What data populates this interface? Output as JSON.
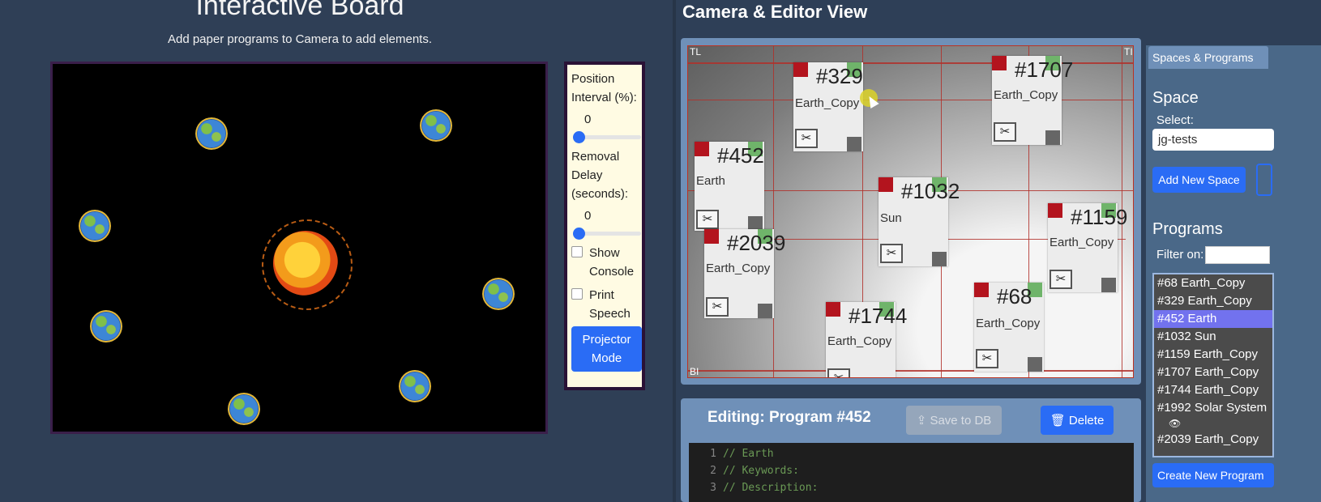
{
  "board": {
    "title": "Interactive Board",
    "subtitle": "Add paper programs to Camera to add elements."
  },
  "controls": {
    "position_interval_label": "Position Interval (%):",
    "position_interval_value": "0",
    "removal_delay_label": "Removal Delay (seconds):",
    "removal_delay_value": "0",
    "show_console_label": "Show Console",
    "print_speech_label": "Print Speech",
    "projector_mode_label": "Projector Mode",
    "slider_color": "#2a6cf5"
  },
  "camera": {
    "title": "Camera & Editor View",
    "corner_tl": "TL",
    "corner_tr": "TI",
    "corner_bl": "BI",
    "papers": [
      {
        "number": "#329",
        "name": "Earth_Copy"
      },
      {
        "number": "#1707",
        "name": "Earth_Copy"
      },
      {
        "number": "#452",
        "name": "Earth"
      },
      {
        "number": "#1032",
        "name": "Sun"
      },
      {
        "number": "#1159",
        "name": "Earth_Copy"
      },
      {
        "number": "#2039",
        "name": "Earth_Copy"
      },
      {
        "number": "#68",
        "name": "Earth_Copy"
      },
      {
        "number": "#1744",
        "name": "Earth_Copy"
      }
    ],
    "cut_icon": "✂"
  },
  "editor": {
    "title": "Editing: Program #452",
    "save_label": "Save to DB",
    "delete_label": "Delete",
    "code_lines": [
      {
        "n": "1",
        "text": "// Earth"
      },
      {
        "n": "2",
        "text": "// Keywords:"
      },
      {
        "n": "3",
        "text": "// Description:"
      }
    ]
  },
  "sidebar": {
    "tab_label": "Spaces & Programs",
    "space_heading": "Space",
    "select_label": "Select:",
    "selected_space": "jg-tests",
    "add_space_label": "Add New Space",
    "programs_heading": "Programs",
    "filter_label": "Filter on:",
    "programs": [
      {
        "label": "#68 Earth_Copy",
        "selected": false
      },
      {
        "label": "#329 Earth_Copy",
        "selected": false
      },
      {
        "label": "#452 Earth",
        "selected": true
      },
      {
        "label": "#1032 Sun",
        "selected": false
      },
      {
        "label": "#1159 Earth_Copy",
        "selected": false
      },
      {
        "label": "#1707 Earth_Copy",
        "selected": false
      },
      {
        "label": "#1744 Earth_Copy",
        "selected": false
      },
      {
        "label": "#1992 Solar System",
        "selected": false
      },
      {
        "label": "#2039 Earth_Copy",
        "selected": false
      }
    ],
    "create_label": "Create New Program"
  }
}
